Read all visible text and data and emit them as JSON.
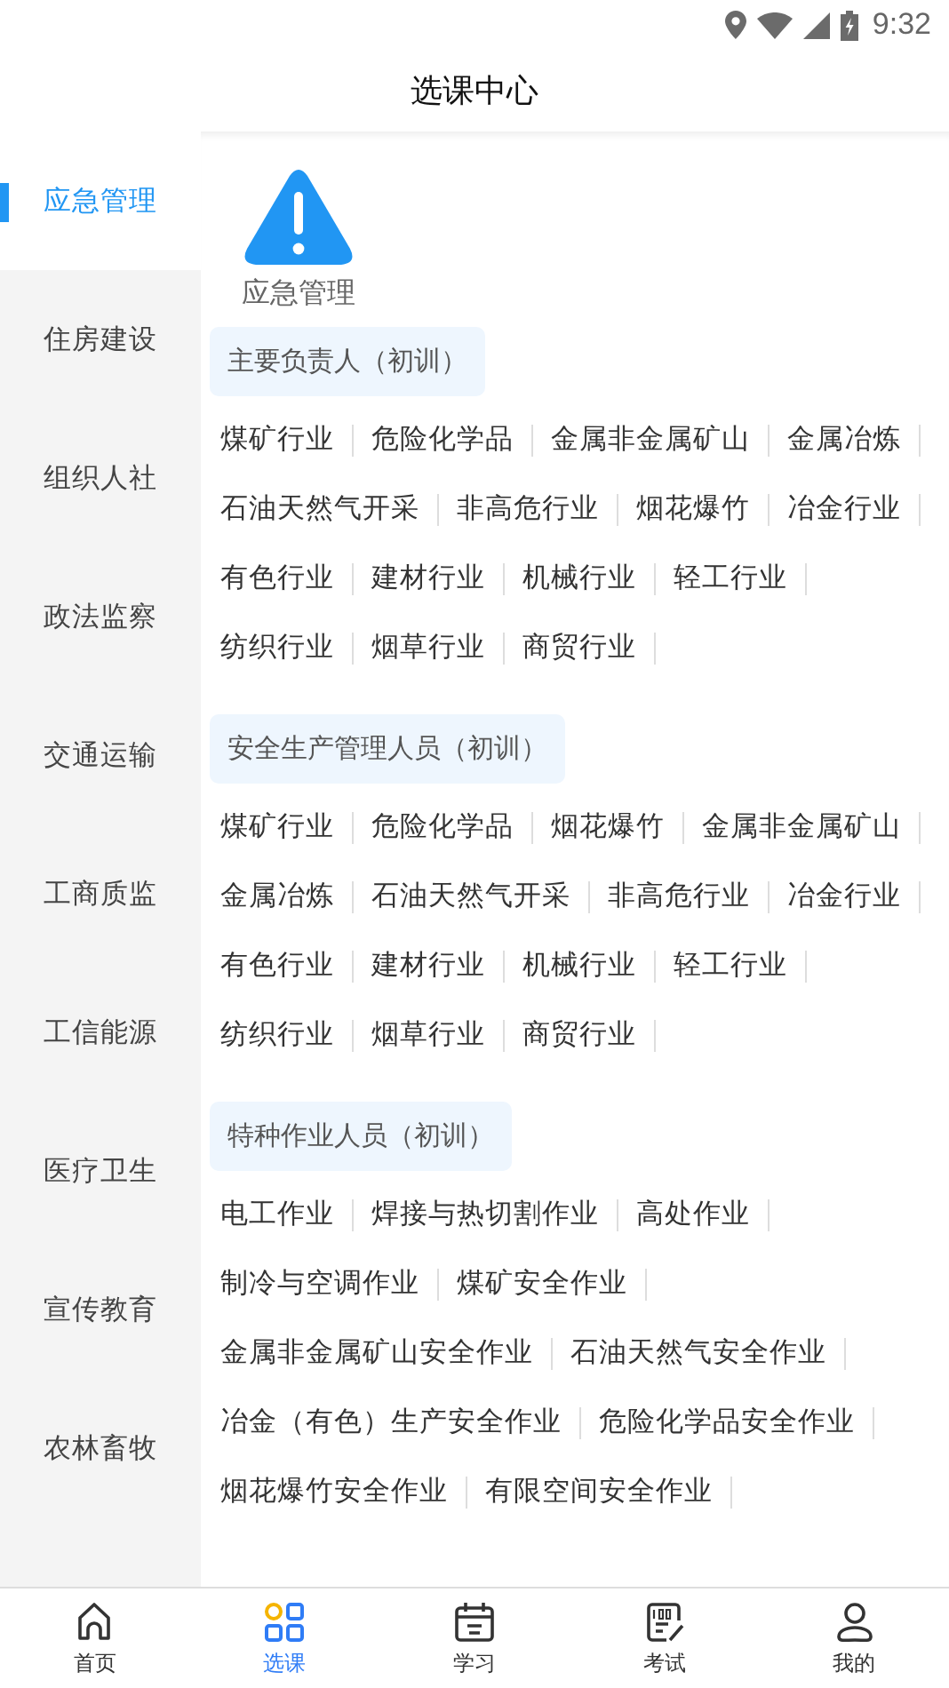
{
  "status_bar": {
    "time": "9:32"
  },
  "header": {
    "title": "选课中心"
  },
  "sidebar": {
    "items": [
      {
        "label": "应急管理",
        "selected": true
      },
      {
        "label": "住房建设",
        "selected": false
      },
      {
        "label": "组织人社",
        "selected": false
      },
      {
        "label": "政法监察",
        "selected": false
      },
      {
        "label": "交通运输",
        "selected": false
      },
      {
        "label": "工商质监",
        "selected": false
      },
      {
        "label": "工信能源",
        "selected": false
      },
      {
        "label": "医疗卫生",
        "selected": false
      },
      {
        "label": "宣传教育",
        "selected": false
      },
      {
        "label": "农林畜牧",
        "selected": false
      }
    ]
  },
  "category": {
    "label": "应急管理"
  },
  "sections": [
    {
      "title": "主要负责人（初训）",
      "courses": [
        "煤矿行业",
        "危险化学品",
        "金属非金属矿山",
        "金属冶炼",
        "石油天然气开采",
        "非高危行业",
        "烟花爆竹",
        "冶金行业",
        "有色行业",
        "建材行业",
        "机械行业",
        "轻工行业",
        "纺织行业",
        "烟草行业",
        "商贸行业"
      ]
    },
    {
      "title": "安全生产管理人员（初训）",
      "courses": [
        "煤矿行业",
        "危险化学品",
        "烟花爆竹",
        "金属非金属矿山",
        "金属冶炼",
        "石油天然气开采",
        "非高危行业",
        "冶金行业",
        "有色行业",
        "建材行业",
        "机械行业",
        "轻工行业",
        "纺织行业",
        "烟草行业",
        "商贸行业"
      ]
    },
    {
      "title": "特种作业人员（初训）",
      "courses": [
        "电工作业",
        "焊接与热切割作业",
        "高处作业",
        "制冷与空调作业",
        "煤矿安全作业",
        "金属非金属矿山安全作业",
        "石油天然气安全作业",
        "冶金（有色）生产安全作业",
        "危险化学品安全作业",
        "烟花爆竹安全作业",
        "有限空间安全作业"
      ]
    }
  ],
  "tab_bar": [
    {
      "label": "首页",
      "kind": "home",
      "selected": false
    },
    {
      "label": "选课",
      "kind": "grid",
      "selected": true
    },
    {
      "label": "学习",
      "kind": "calendar",
      "selected": false
    },
    {
      "label": "考试",
      "kind": "exam",
      "selected": false
    },
    {
      "label": "我的",
      "kind": "person",
      "selected": false
    }
  ]
}
